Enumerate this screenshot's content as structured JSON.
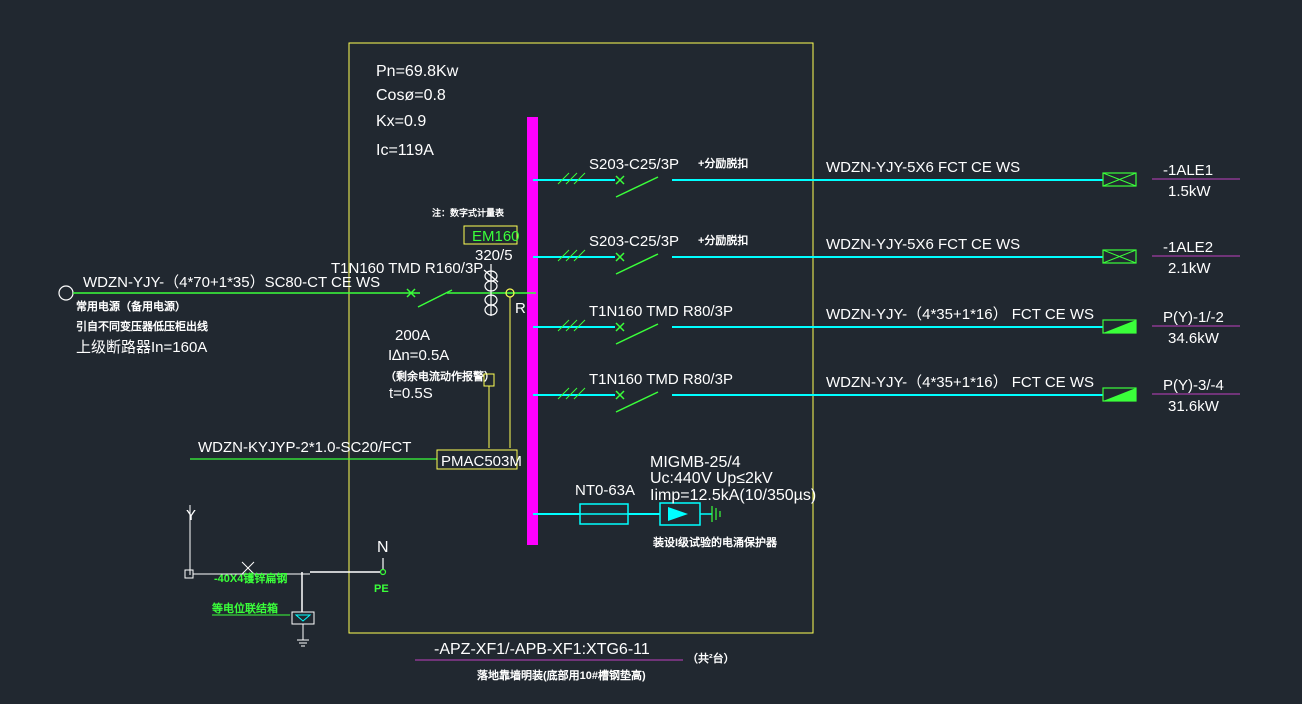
{
  "panel": {
    "params": [
      "Pn=69.8Kw",
      "Cosø=0.8",
      "Kx=0.9",
      "Ic=119A"
    ],
    "id": "-APZ-XF1/-APB-XF1:XTG6-11",
    "qty": "（共²台）",
    "install_note": "落地靠墙明装(底部用10#槽钢垫高)"
  },
  "incoming": {
    "cable": "WDZN-YJY-（4*70+1*35）SC80-CT CE WS",
    "note1": "常用电源（备用电源）",
    "note2": "引自不同变压器低压柜出线",
    "note3": "上级断路器In=160A",
    "breaker": "T1N160 TMD R160/3P",
    "rating": "200A",
    "idn": "I∆n=0.5A",
    "rcd_note": "（剩余电流动作报警）",
    "time": "t=0.5S",
    "meter_note": "注：数字式计量表",
    "meter": "EM160",
    "ct": "320/5",
    "r_label": "R"
  },
  "monitor": {
    "cable": "WDZN-KYJYP-2*1.0-SC20/FCT",
    "device": "PMAC503M"
  },
  "circuits": [
    {
      "breaker": "S203-C25/3P",
      "aux": "+分励脱扣",
      "cable": "WDZN-YJY-5X6  FCT  CE WS",
      "id": "-1ALE1",
      "power": "1.5kW"
    },
    {
      "breaker": "S203-C25/3P",
      "aux": "+分励脱扣",
      "cable": "WDZN-YJY-5X6  FCT  CE WS",
      "id": "-1ALE2",
      "power": "2.1kW"
    },
    {
      "breaker": "T1N160 TMD R80/3P",
      "aux": "",
      "cable": "WDZN-YJY-（4*35+1*16） FCT  CE WS",
      "id": "P(Y)-1/-2",
      "power": "34.6kW"
    },
    {
      "breaker": "T1N160 TMD R80/3P",
      "aux": "",
      "cable": "WDZN-YJY-（4*35+1*16） FCT  CE WS",
      "id": "P(Y)-3/-4",
      "power": "31.6kW"
    }
  ],
  "spd": {
    "fuse": "NT0-63A",
    "model": "MIGMB-25/4",
    "uc": "Uc:440V Up≤2kV",
    "iimp": "Iimp=12.5kA(10/350µs)",
    "note": "装设I级试验的电涌保护器"
  },
  "grounding": {
    "n": "N",
    "pe": "PE",
    "y": "Y",
    "strip": "-40X4镬锌扁钢",
    "box": "等电位联结箱"
  },
  "colors": {
    "background": "#212830",
    "frame": "#ffff55",
    "busbar": "#ff00ff",
    "feeder": "#00ffff",
    "wire": "#3aff3a",
    "text": "#ffffff"
  }
}
